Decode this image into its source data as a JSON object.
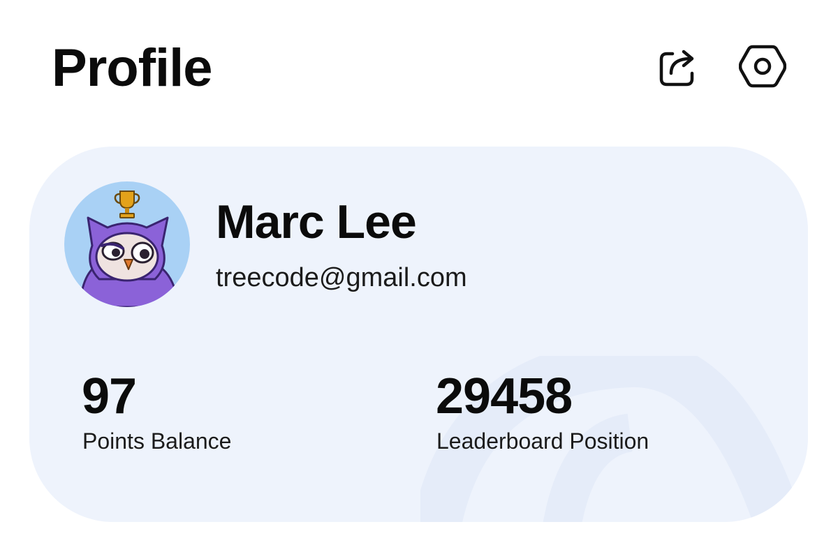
{
  "header": {
    "title": "Profile",
    "actions": [
      {
        "name": "share",
        "icon": "share-icon"
      },
      {
        "name": "settings",
        "icon": "settings-icon"
      }
    ]
  },
  "profile": {
    "name": "Marc Lee",
    "email": "treecode@gmail.com",
    "avatar": {
      "icon": "owl-avatar-with-trophy",
      "background": "#a9d1f5"
    }
  },
  "stats": {
    "points": {
      "value": "97",
      "label": "Points Balance"
    },
    "leaderboard": {
      "value": "29458",
      "label": "Leaderboard Position"
    }
  },
  "colors": {
    "card_background": "#eef3fc",
    "text": "#0b0b0b",
    "owl_purple": "#8b62d8"
  }
}
